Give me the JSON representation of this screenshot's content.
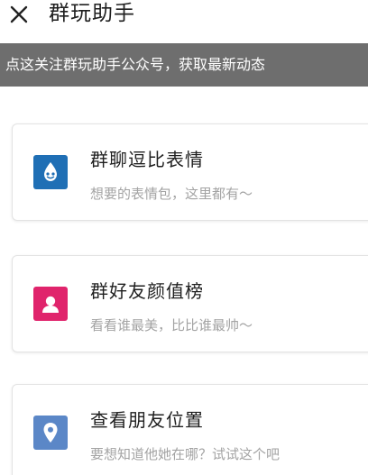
{
  "header": {
    "title": "群玩助手",
    "close_icon": "close-icon"
  },
  "banner": {
    "text": "点这关注群玩助手公众号，获取最新动态"
  },
  "cards": [
    {
      "title": "群聊逗比表情",
      "desc": "想要的表情包，这里都有～",
      "icon": "droplet-face-icon",
      "color": "#1f6fb5"
    },
    {
      "title": "群好友颜值榜",
      "desc": "看看谁最美，比比谁最帅～",
      "icon": "person-icon",
      "color": "#e0246c"
    },
    {
      "title": "查看朋友位置",
      "desc": "要想知道他她在哪？试试这个吧",
      "icon": "location-pin-icon",
      "color": "#5b87c7"
    }
  ]
}
